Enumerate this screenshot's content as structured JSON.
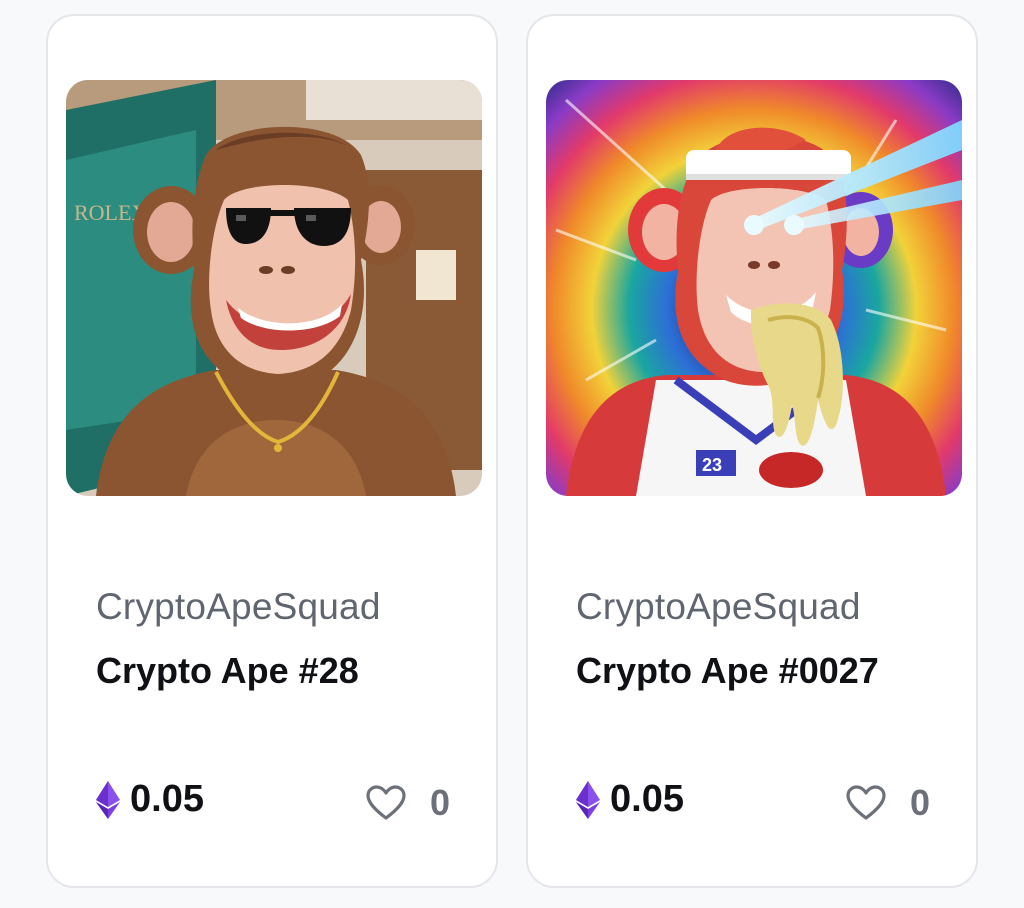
{
  "cards": [
    {
      "collection": "CryptoApeSquad",
      "title": "Crypto Ape #28",
      "price": "0.05",
      "currency_icon": "ethereum-icon",
      "like_icon": "heart-outline-icon",
      "likes": "0",
      "image": "pixel-art brown ape with black sunglasses and gold chain",
      "image_background_sign": "ROLEX"
    },
    {
      "collection": "CryptoApeSquad",
      "title": "Crypto Ape #0027",
      "price": "0.05",
      "currency_icon": "ethereum-icon",
      "like_icon": "heart-outline-icon",
      "likes": "0",
      "image": "pixel-art red-haired ape with laser eyes, headband and basketball jersey",
      "image_jersey_number": "23"
    }
  ],
  "colors": {
    "eth_purple": "#7b3fe4",
    "text_dark": "#0f1115",
    "text_muted": "#5f6670",
    "card_border": "#e4e6ea"
  }
}
